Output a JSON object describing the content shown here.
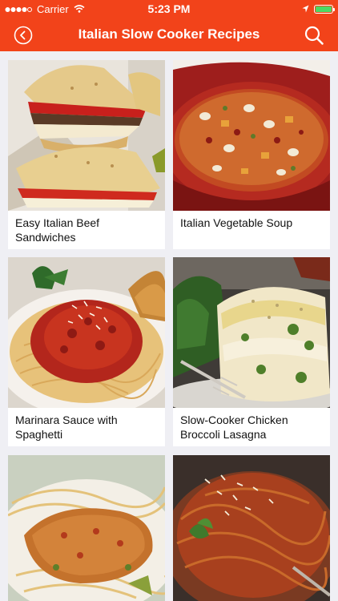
{
  "status": {
    "carrier": "Carrier",
    "time": "5:23 PM"
  },
  "nav": {
    "title": "Italian Slow Cooker Recipes",
    "back_icon": "back-circle-icon",
    "search_icon": "search-icon"
  },
  "colors": {
    "header": "#f2431a",
    "background": "#efeff4"
  },
  "recipes": [
    {
      "title": "Easy Italian Beef Sandwiches"
    },
    {
      "title": "Italian Vegetable Soup"
    },
    {
      "title": "Marinara Sauce with Spaghetti"
    },
    {
      "title": "Slow-Cooker Chicken Broccoli Lasagna"
    },
    {
      "title": ""
    },
    {
      "title": ""
    }
  ]
}
